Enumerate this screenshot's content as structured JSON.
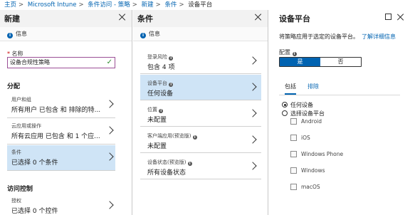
{
  "breadcrumb": [
    "主页",
    "Microsoft Intune",
    "条件访问 - 策略",
    "新建",
    "条件",
    "设备平台"
  ],
  "blade_new": {
    "title": "新建",
    "info": "信息",
    "name_label": "名称",
    "name_value": "设备合规性策略",
    "section_assign": "分配",
    "cards": [
      {
        "key": "用户和组",
        "value": "所有用户 已包含 和 排除的特..."
      },
      {
        "key": "云应用或操作",
        "value": "所有云应用 已包含 和 1 个应..."
      },
      {
        "key": "条件",
        "value": "已选择 0 个条件"
      }
    ],
    "section_access": "访问控制",
    "grant": {
      "key": "授权",
      "value": "已选择 0 个控件"
    }
  },
  "blade_conditions": {
    "title": "条件",
    "info": "信息",
    "items": [
      {
        "key": "登录风险",
        "value": "包含 4 项"
      },
      {
        "key": "设备平台",
        "value": "任何设备"
      },
      {
        "key": "位置",
        "value": "未配置"
      },
      {
        "key": "客户端应用(预览版)",
        "value": "未配置"
      },
      {
        "key": "设备状态(预览版)",
        "value": "所有设备状态"
      }
    ]
  },
  "blade_platform": {
    "title": "设备平台",
    "description": "将策略应用于选定的设备平台。",
    "learn_more": "了解详细信息",
    "configure_label": "配置",
    "toggle_yes": "是",
    "toggle_no": "否",
    "tab_include": "包括",
    "tab_exclude": "排除",
    "radio_any": "任何设备",
    "radio_select": "选择设备平台",
    "platforms": [
      "Android",
      "iOS",
      "Windows Phone",
      "Windows",
      "macOS"
    ]
  }
}
